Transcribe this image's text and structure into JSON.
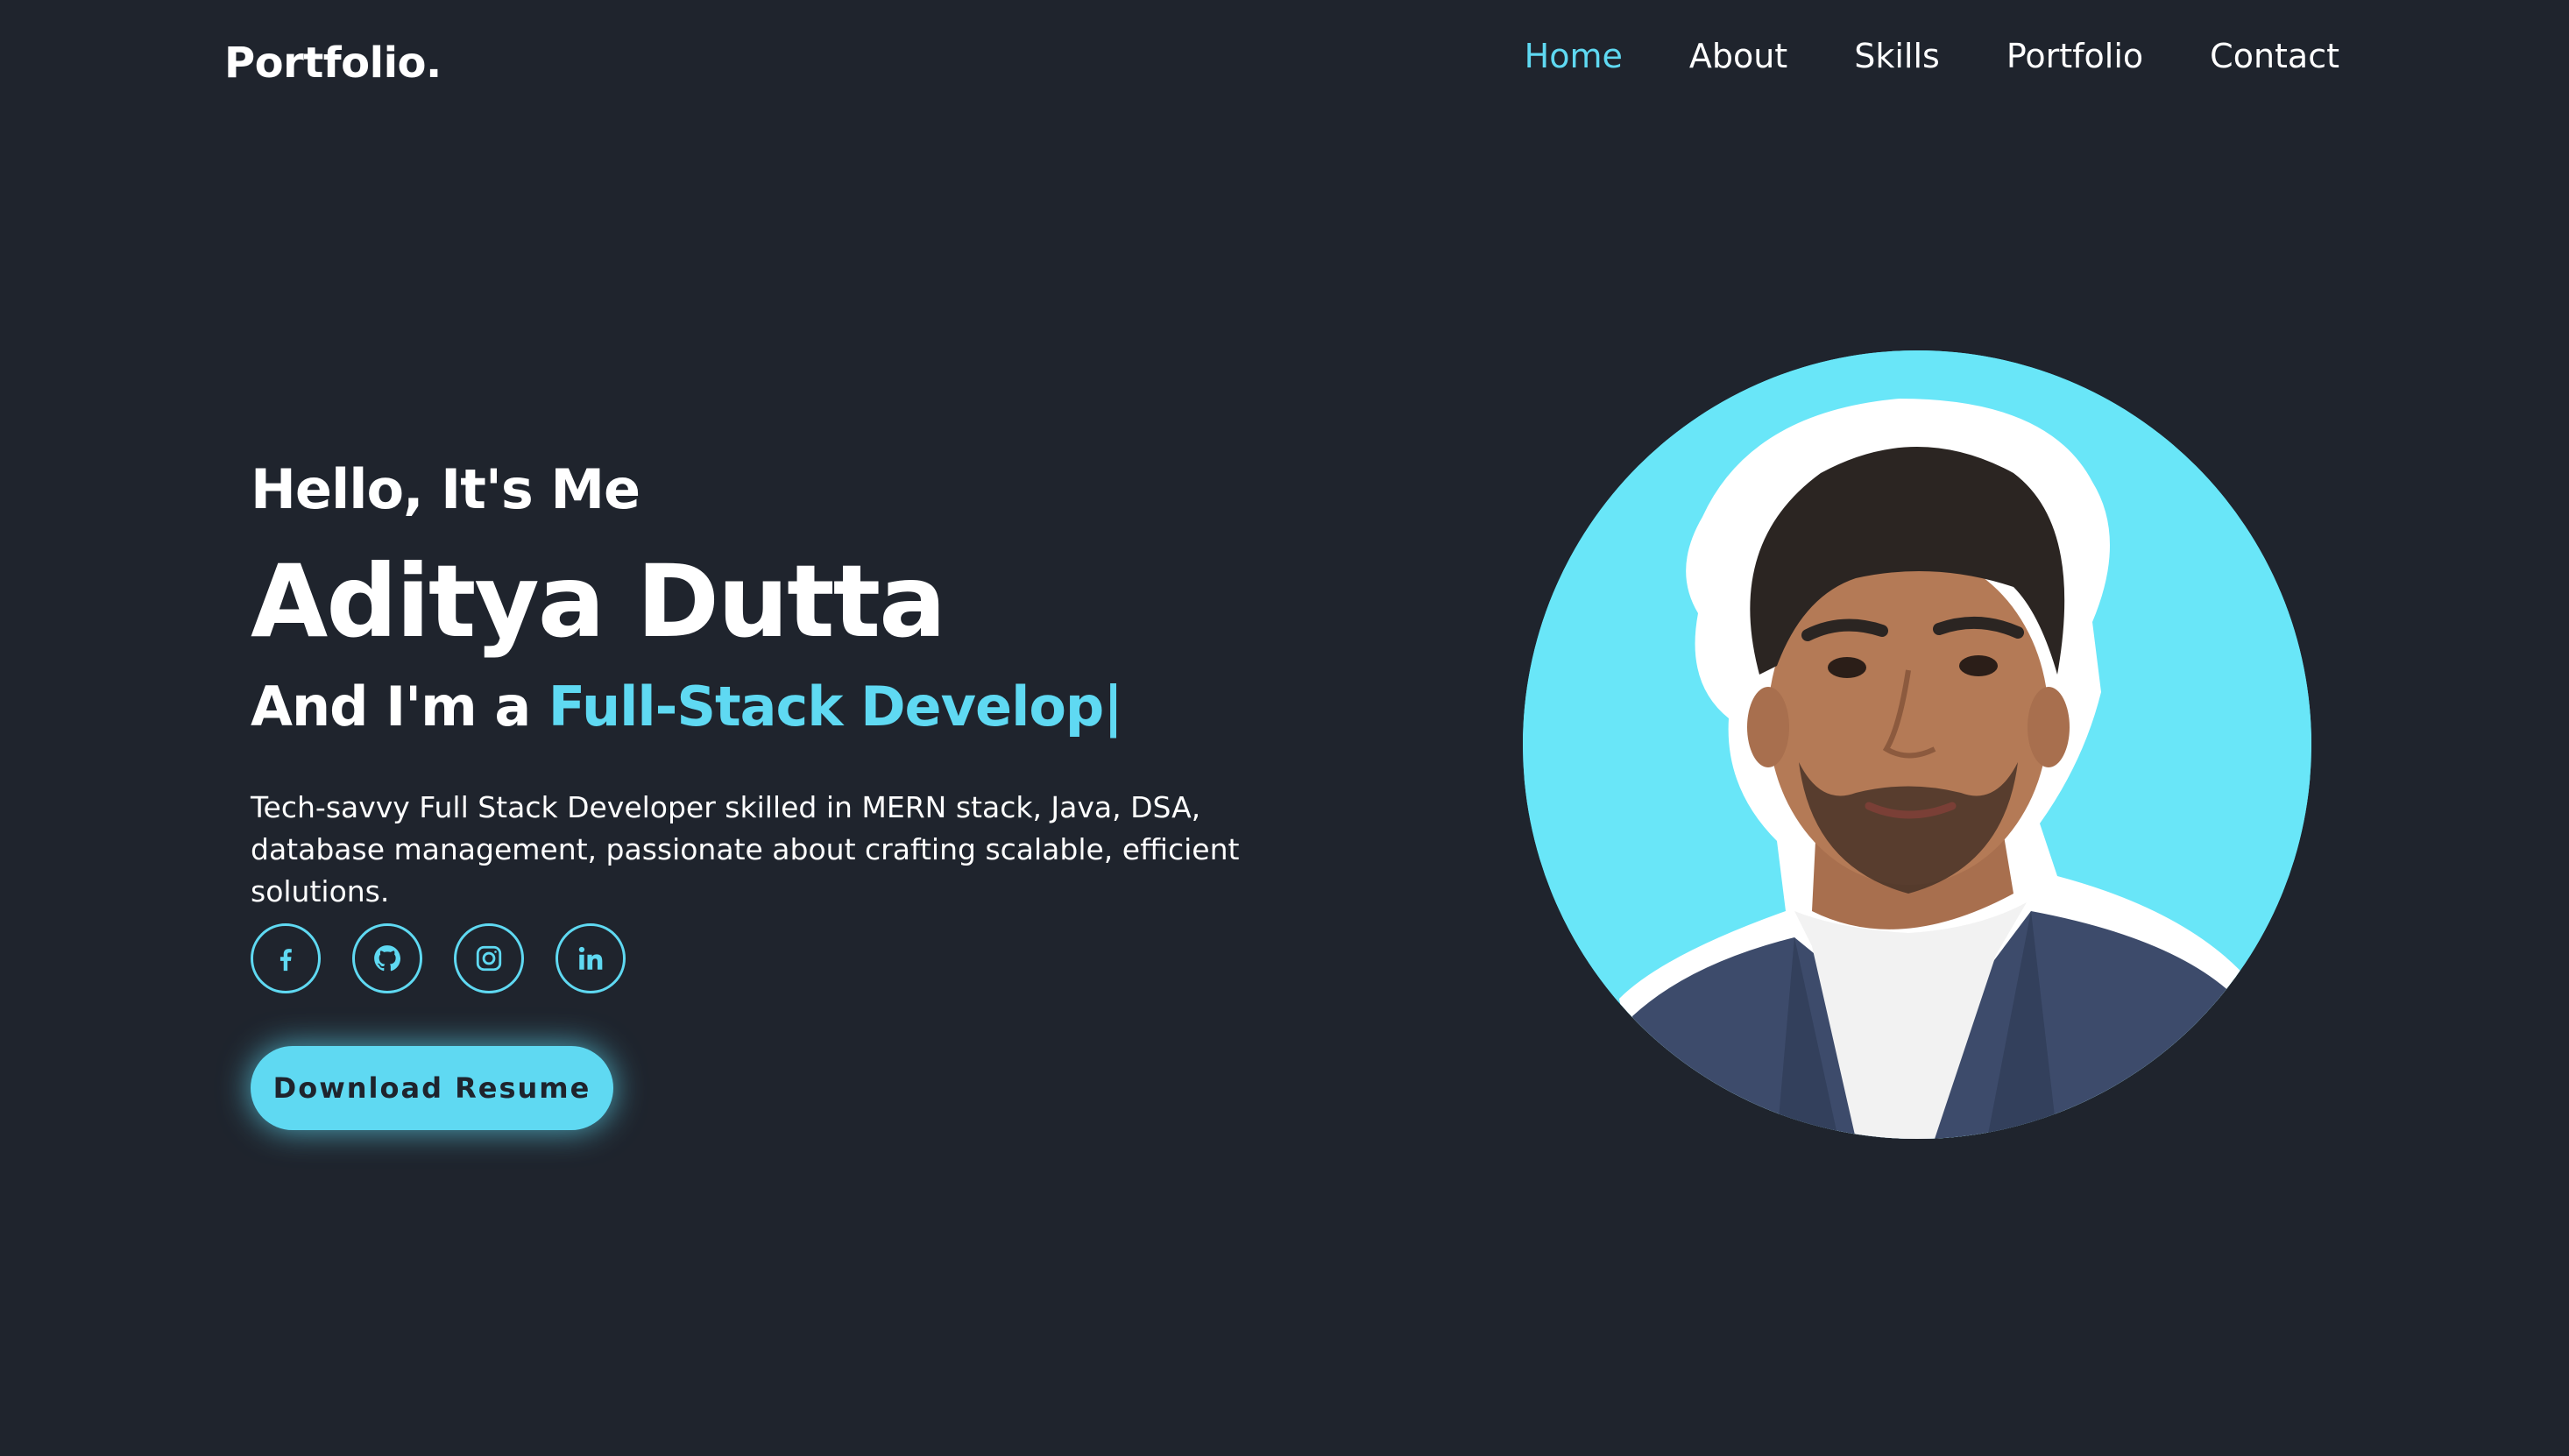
{
  "header": {
    "logo": "Portfolio.",
    "nav": [
      {
        "label": "Home",
        "active": true
      },
      {
        "label": "About"
      },
      {
        "label": "Skills"
      },
      {
        "label": "Portfolio"
      },
      {
        "label": "Contact"
      }
    ]
  },
  "hero": {
    "greeting": "Hello, It's Me",
    "name": "Aditya Dutta",
    "role_prefix": "And I'm a ",
    "role_typed": "Full-Stack Develop",
    "cursor": "|",
    "description": "Tech-savvy Full Stack Developer skilled in MERN stack, Java, DSA, database management, passionate about crafting scalable, efficient solutions.",
    "socials": [
      {
        "icon": "facebook-icon"
      },
      {
        "icon": "github-icon"
      },
      {
        "icon": "instagram-icon"
      },
      {
        "icon": "linkedin-icon"
      }
    ],
    "button_label": "Download Resume"
  },
  "colors": {
    "background": "#1f242d",
    "accent": "#5fd9f2",
    "text": "#ffffff"
  }
}
